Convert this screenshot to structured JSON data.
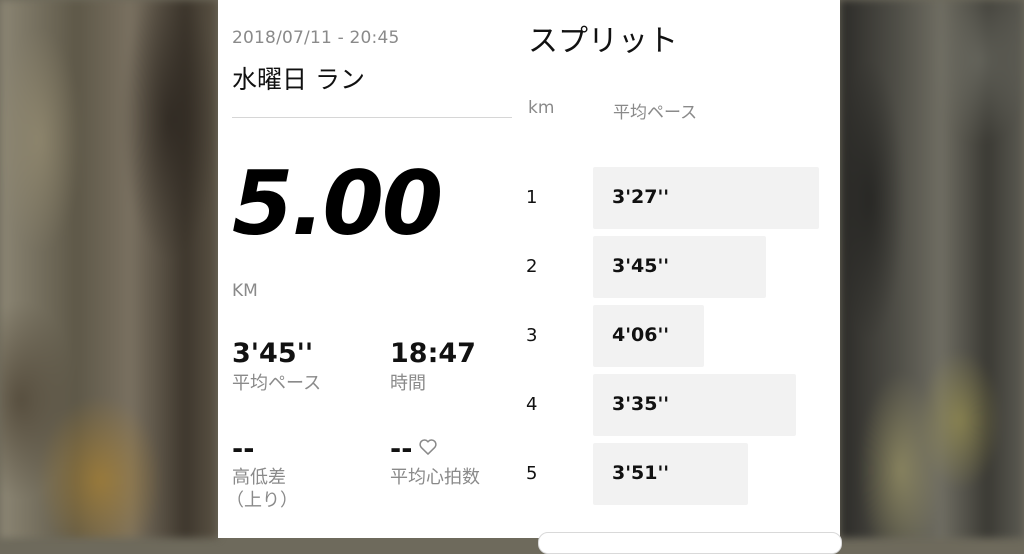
{
  "activity": {
    "datetime": "2018/07/11 - 20:45",
    "name": "水曜日 ラン",
    "distance": "5.00",
    "distance_unit": "KM"
  },
  "stats": {
    "avg_pace": {
      "value": "3'45''",
      "label": "平均ペース"
    },
    "time": {
      "value": "18:47",
      "label": "時間"
    },
    "elevation": {
      "value": "--",
      "label": "高低差",
      "sublabel": "（上り）"
    },
    "heart_rate": {
      "value": "--",
      "label": "平均心拍数",
      "icon": "heart-outline-icon"
    }
  },
  "splits": {
    "title": "スプリット",
    "col_km": "km",
    "col_pace": "平均ペース",
    "rows": [
      {
        "km": "1",
        "pace": "3'27''",
        "pace_seconds": 207
      },
      {
        "km": "2",
        "pace": "3'45''",
        "pace_seconds": 225
      },
      {
        "km": "3",
        "pace": "4'06''",
        "pace_seconds": 246
      },
      {
        "km": "4",
        "pace": "3'35''",
        "pace_seconds": 215
      },
      {
        "km": "5",
        "pace": "3'51''",
        "pace_seconds": 231
      }
    ]
  },
  "colors": {
    "bar": "#f2f2f2",
    "label_gray": "#8a8a8a",
    "text": "#111111"
  }
}
